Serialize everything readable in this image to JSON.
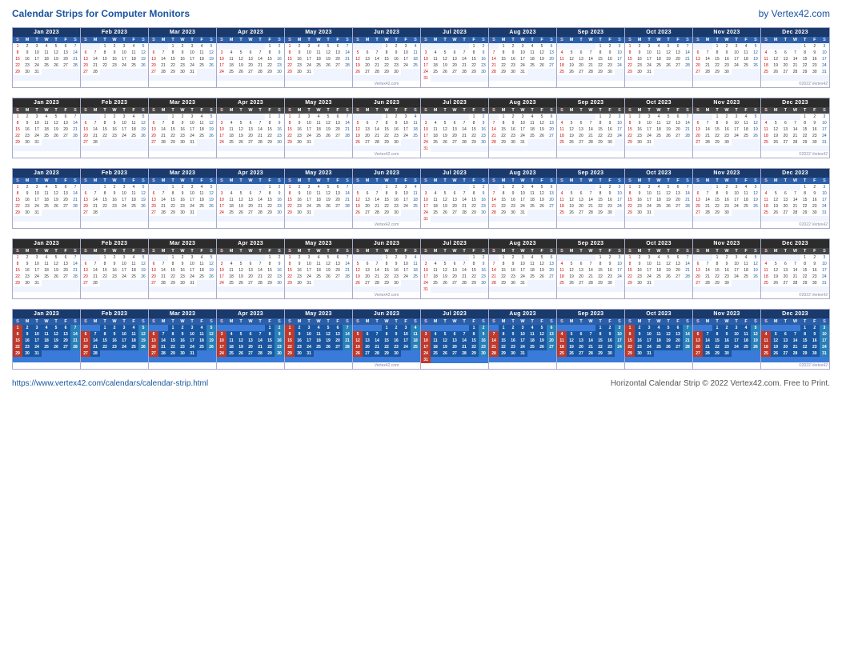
{
  "header": {
    "title": "Calendar Strips for Computer Monitors",
    "credit": "by Vertex42.com"
  },
  "footer": {
    "url": "https://www.vertex42.com/calendars/calendar-strip.html",
    "copyright": "Horizontal Calendar Strip © 2022 Vertex42.com. Free to Print."
  },
  "months": [
    {
      "name": "Jan 2023",
      "days_before": 0,
      "total_days": 31
    },
    {
      "name": "Feb 2023",
      "days_before": 2,
      "total_days": 28
    },
    {
      "name": "Mar 2023",
      "days_before": 2,
      "total_days": 31
    },
    {
      "name": "Apr 2023",
      "days_before": 5,
      "total_days": 30
    },
    {
      "name": "May 2023",
      "days_before": 0,
      "total_days": 31
    },
    {
      "name": "Jun 2023",
      "days_before": 3,
      "total_days": 30
    },
    {
      "name": "Jul 2023",
      "days_before": 5,
      "total_days": 31
    },
    {
      "name": "Aug 2023",
      "days_before": 1,
      "total_days": 31
    },
    {
      "name": "Sep 2023",
      "days_before": 4,
      "total_days": 30
    },
    {
      "name": "Oct 2023",
      "days_before": 0,
      "total_days": 31
    },
    {
      "name": "Nov 2023",
      "days_before": 2,
      "total_days": 30
    },
    {
      "name": "Dec 2023",
      "days_before": 4,
      "total_days": 31
    }
  ],
  "day_headers": [
    "S",
    "M",
    "T",
    "W",
    "T",
    "F",
    "S"
  ],
  "strips": [
    {
      "id": "strip-1",
      "variant": "strip-1"
    },
    {
      "id": "strip-2",
      "variant": "strip-2"
    },
    {
      "id": "strip-3",
      "variant": "strip-3"
    },
    {
      "id": "strip-4",
      "variant": "strip-4"
    },
    {
      "id": "strip-5",
      "variant": "strip-5"
    }
  ]
}
